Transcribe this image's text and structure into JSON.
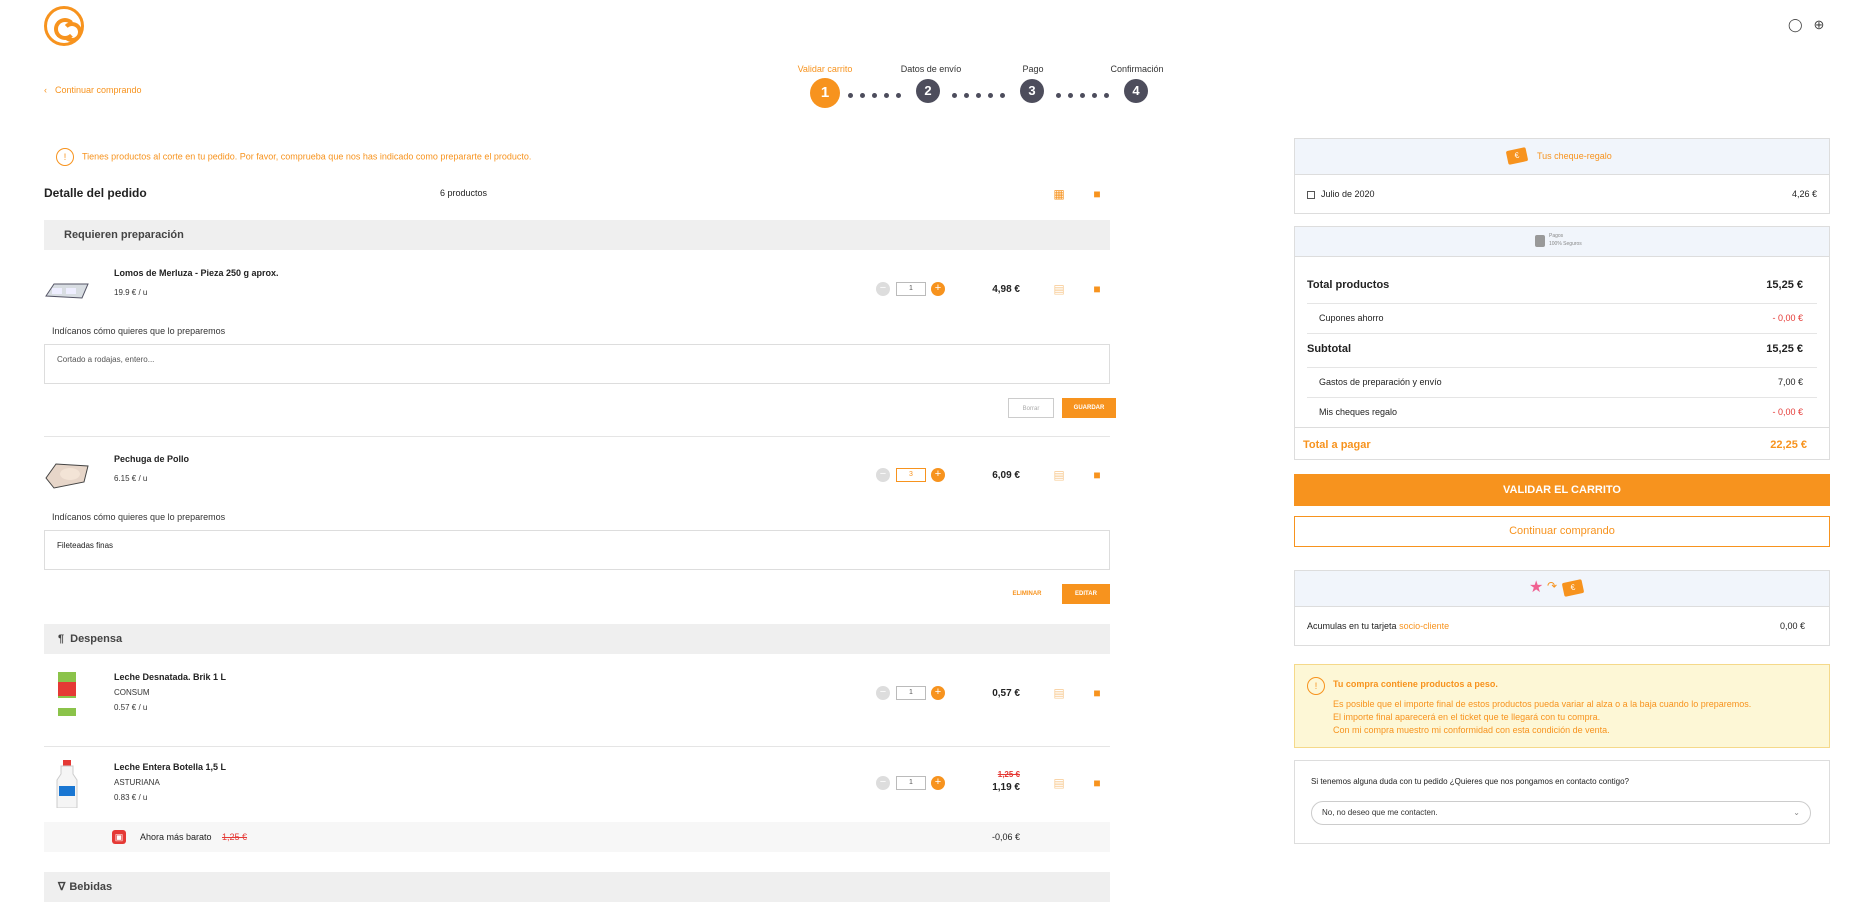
{
  "header": {
    "back_label": "Continuar comprando",
    "steps": [
      {
        "label": "Validar carrito",
        "num": "1"
      },
      {
        "label": "Datos de envío",
        "num": "2"
      },
      {
        "label": "Pago",
        "num": "3"
      },
      {
        "label": "Confirmación",
        "num": "4"
      }
    ]
  },
  "notice": "Tienes productos al corte en tu pedido. Por favor, comprueba que nos has indicado como prepararte el producto.",
  "order": {
    "title": "Detalle del pedido",
    "count": "6 productos",
    "sections": {
      "prep": "Requieren preparación",
      "pantry": "Despensa",
      "drinks": "Bebidas"
    },
    "prep_question": "Indícanos cómo quieres que lo preparemos",
    "products": [
      {
        "name": "Lomos de Merluza - Pieza 250 g aprox.",
        "unit": "19.9 € / u",
        "qty": "1",
        "price": "4,98 €",
        "prep_placeholder": "Cortado a rodajas, entero...",
        "btn_a": "Borrar",
        "btn_b": "GUARDAR"
      },
      {
        "name": "Pechuga de Pollo",
        "unit": "6.15 € / u",
        "qty": "3",
        "price": "6,09 €",
        "prep_value": "Fileteadas finas",
        "btn_a": "ELIMINAR",
        "btn_b": "EDITAR"
      },
      {
        "name": "Leche Desnatada. Brik 1 L",
        "brand": "CONSUM",
        "unit": "0.57 € / u",
        "qty": "1",
        "price": "0,57 €"
      },
      {
        "name": "Leche Entera Botella 1,5 L",
        "brand": "ASTURIANA",
        "unit": "0.83 € / u",
        "qty": "1",
        "old_price": "1,25 €",
        "price": "1,19 €"
      }
    ],
    "promo": {
      "label": "Ahora más barato",
      "old": "1,25 €",
      "discount": "-0,06 €"
    }
  },
  "sidebar": {
    "cheques_title": "Tus cheque-regalo",
    "cheque_item": {
      "label": "Julio de 2020",
      "value": "4,26 €"
    },
    "secure": {
      "line1": "Pagos",
      "line2": "100% Seguros"
    },
    "totals": {
      "products_label": "Total productos",
      "products": "15,25 €",
      "coupons_label": "Cupones ahorro",
      "coupons": "- 0,00 €",
      "subtotal_label": "Subtotal",
      "subtotal": "15,25 €",
      "shipping_label": "Gastos de preparación y envío",
      "shipping": "7,00 €",
      "cheques_label": "Mis cheques regalo",
      "cheques": "- 0,00 €",
      "total_label": "Total a pagar",
      "total": "22,25 €"
    },
    "validate_btn": "VALIDAR EL CARRITO",
    "continue_btn": "Continuar comprando",
    "card": {
      "label": "Acumulas en tu tarjeta",
      "link": "socio-cliente",
      "value": "0,00 €"
    },
    "weight_notice": {
      "title": "Tu compra contiene productos a peso.",
      "line1": "Es posible que el importe final de estos productos pueda variar al alza o a la baja cuando lo preparemos.",
      "line2": "El importe final aparecerá en el ticket que te llegará con tu compra.",
      "line3": "Con mi compra muestro mi conformidad con esta condición de venta."
    },
    "contact": {
      "question": "Si tenemos alguna duda con tu pedido ¿Quieres que nos pongamos en contacto contigo?",
      "selected": "No, no deseo que me contacten."
    }
  }
}
